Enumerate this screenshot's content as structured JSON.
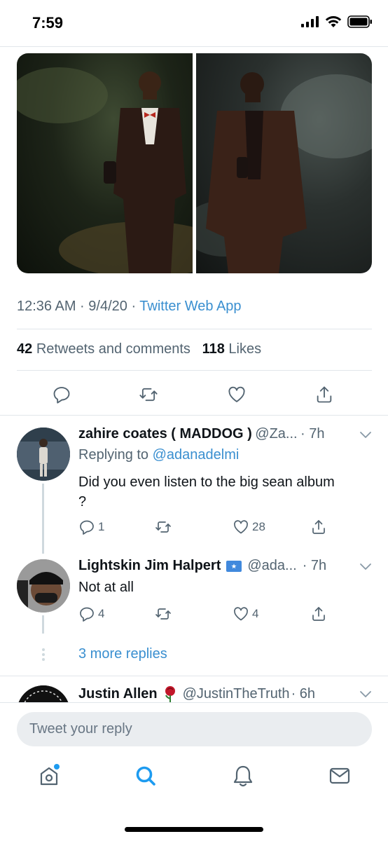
{
  "status_bar": {
    "time": "7:59"
  },
  "tweet": {
    "timestamp": "12:36 AM · 9/4/20 · ",
    "source": "Twitter Web App",
    "retweets_count": "42",
    "retweets_label": "Retweets and comments",
    "likes_count": "118",
    "likes_label": "Likes"
  },
  "replies": [
    {
      "name": "zahire coates ( MADDOG )",
      "handle": "@Za...",
      "time": "· 7h",
      "replying_prefix": "Replying to ",
      "replying_handle": "@adanadelmi",
      "text_line1": "Did you even listen to the big sean album",
      "text_line2": "?",
      "reply_count": "1",
      "like_count": "28"
    },
    {
      "name": "Lightskin Jim Halpert",
      "handle": "@ada...",
      "time": "· 7h",
      "text_line1": "Not at all",
      "reply_count": "4",
      "like_count": "4"
    },
    {
      "name": "Justin Allen",
      "handle": "@JustinTheTruth",
      "time": "· 6h"
    }
  ],
  "more_replies": "3 more replies",
  "reply_box": {
    "placeholder": "Tweet your reply"
  },
  "colors": {
    "accent": "#1d9bf0",
    "link": "#3a8fd0",
    "secondary_text": "#536471"
  }
}
